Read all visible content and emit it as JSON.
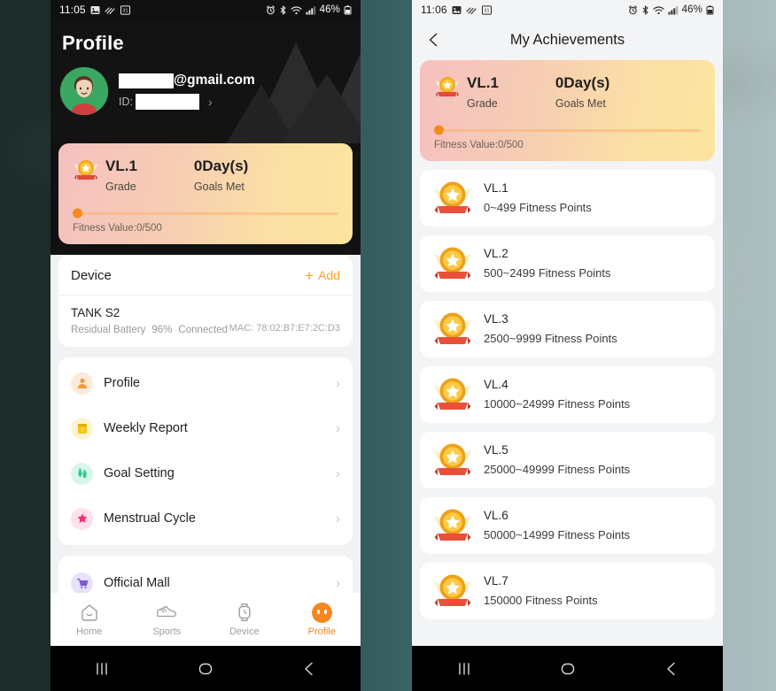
{
  "left_phone": {
    "status_bar": {
      "time": "11:05",
      "battery": "46%",
      "icons": [
        "photo-icon",
        "motion-icon",
        "calendar-31-icon",
        "alarm-icon",
        "bluetooth-icon",
        "wifi-icon",
        "signal-icon",
        "battery-icon"
      ]
    },
    "page_title": "Profile",
    "account": {
      "email_suffix": "@gmail.com",
      "email_redacted": true,
      "id_label": "ID:",
      "id_redacted": true
    },
    "achievement_card": {
      "grade_value": "VL.1",
      "grade_label": "Grade",
      "goals_value": "0Day(s)",
      "goals_label": "Goals Met",
      "fitness_label": "Fitness Value:0/500",
      "progress_percent": 0
    },
    "device_section": {
      "title": "Device",
      "add_label": "Add",
      "device_name": "TANK S2",
      "battery_label": "Residual Battery",
      "battery_value": "96%",
      "connection_status": "Connected",
      "mac": "MAC: 78:02:B7:E7:2C:D3"
    },
    "menu": [
      {
        "label": "Profile",
        "icon": "person-icon",
        "color": "#f59a3c",
        "bg": "#fdebd9"
      },
      {
        "label": "Weekly Report",
        "icon": "calendar-icon",
        "color": "#f5c518",
        "bg": "#fdf3d3"
      },
      {
        "label": "Goal Setting",
        "icon": "footsteps-icon",
        "color": "#2ecc8f",
        "bg": "#d9f6ea"
      },
      {
        "label": "Menstrual Cycle",
        "icon": "flower-icon",
        "color": "#f4316d",
        "bg": "#fde0e9"
      }
    ],
    "menu_secondary": [
      {
        "label": "Official Mall",
        "icon": "cart-icon",
        "color": "#7b5cd6",
        "bg": "#e8e1fb"
      }
    ],
    "bottom_nav": [
      {
        "label": "Home",
        "icon": "home-icon",
        "active": false
      },
      {
        "label": "Sports",
        "icon": "shoe-icon",
        "active": false
      },
      {
        "label": "Device",
        "icon": "watch-icon",
        "active": false
      },
      {
        "label": "Profile",
        "icon": "profile-avatar-icon",
        "active": true
      }
    ],
    "accent_color": "#f4871f"
  },
  "right_phone": {
    "status_bar": {
      "time": "11:06",
      "battery": "46%"
    },
    "header_title": "My Achievements",
    "achievement_card": {
      "grade_value": "VL.1",
      "grade_label": "Grade",
      "goals_value": "0Day(s)",
      "goals_label": "Goals Met",
      "fitness_label": "Fitness Value:0/500",
      "progress_percent": 0
    },
    "levels": [
      {
        "name": "VL.1",
        "range": "0~499",
        "unit": "Fitness Points"
      },
      {
        "name": "VL.2",
        "range": "500~2499",
        "unit": "Fitness Points"
      },
      {
        "name": "VL.3",
        "range": "2500~9999",
        "unit": "Fitness Points"
      },
      {
        "name": "VL.4",
        "range": "10000~24999",
        "unit": "Fitness Points"
      },
      {
        "name": "VL.5",
        "range": "25000~49999",
        "unit": "Fitness Points"
      },
      {
        "name": "VL.6",
        "range": "50000~14999",
        "unit": "Fitness Points"
      },
      {
        "name": "VL.7",
        "range": "150000",
        "unit": "Fitness Points"
      }
    ]
  },
  "system_nav": {
    "recents": "recents-icon",
    "home": "home-circle-icon",
    "back": "back-chevron-icon"
  }
}
